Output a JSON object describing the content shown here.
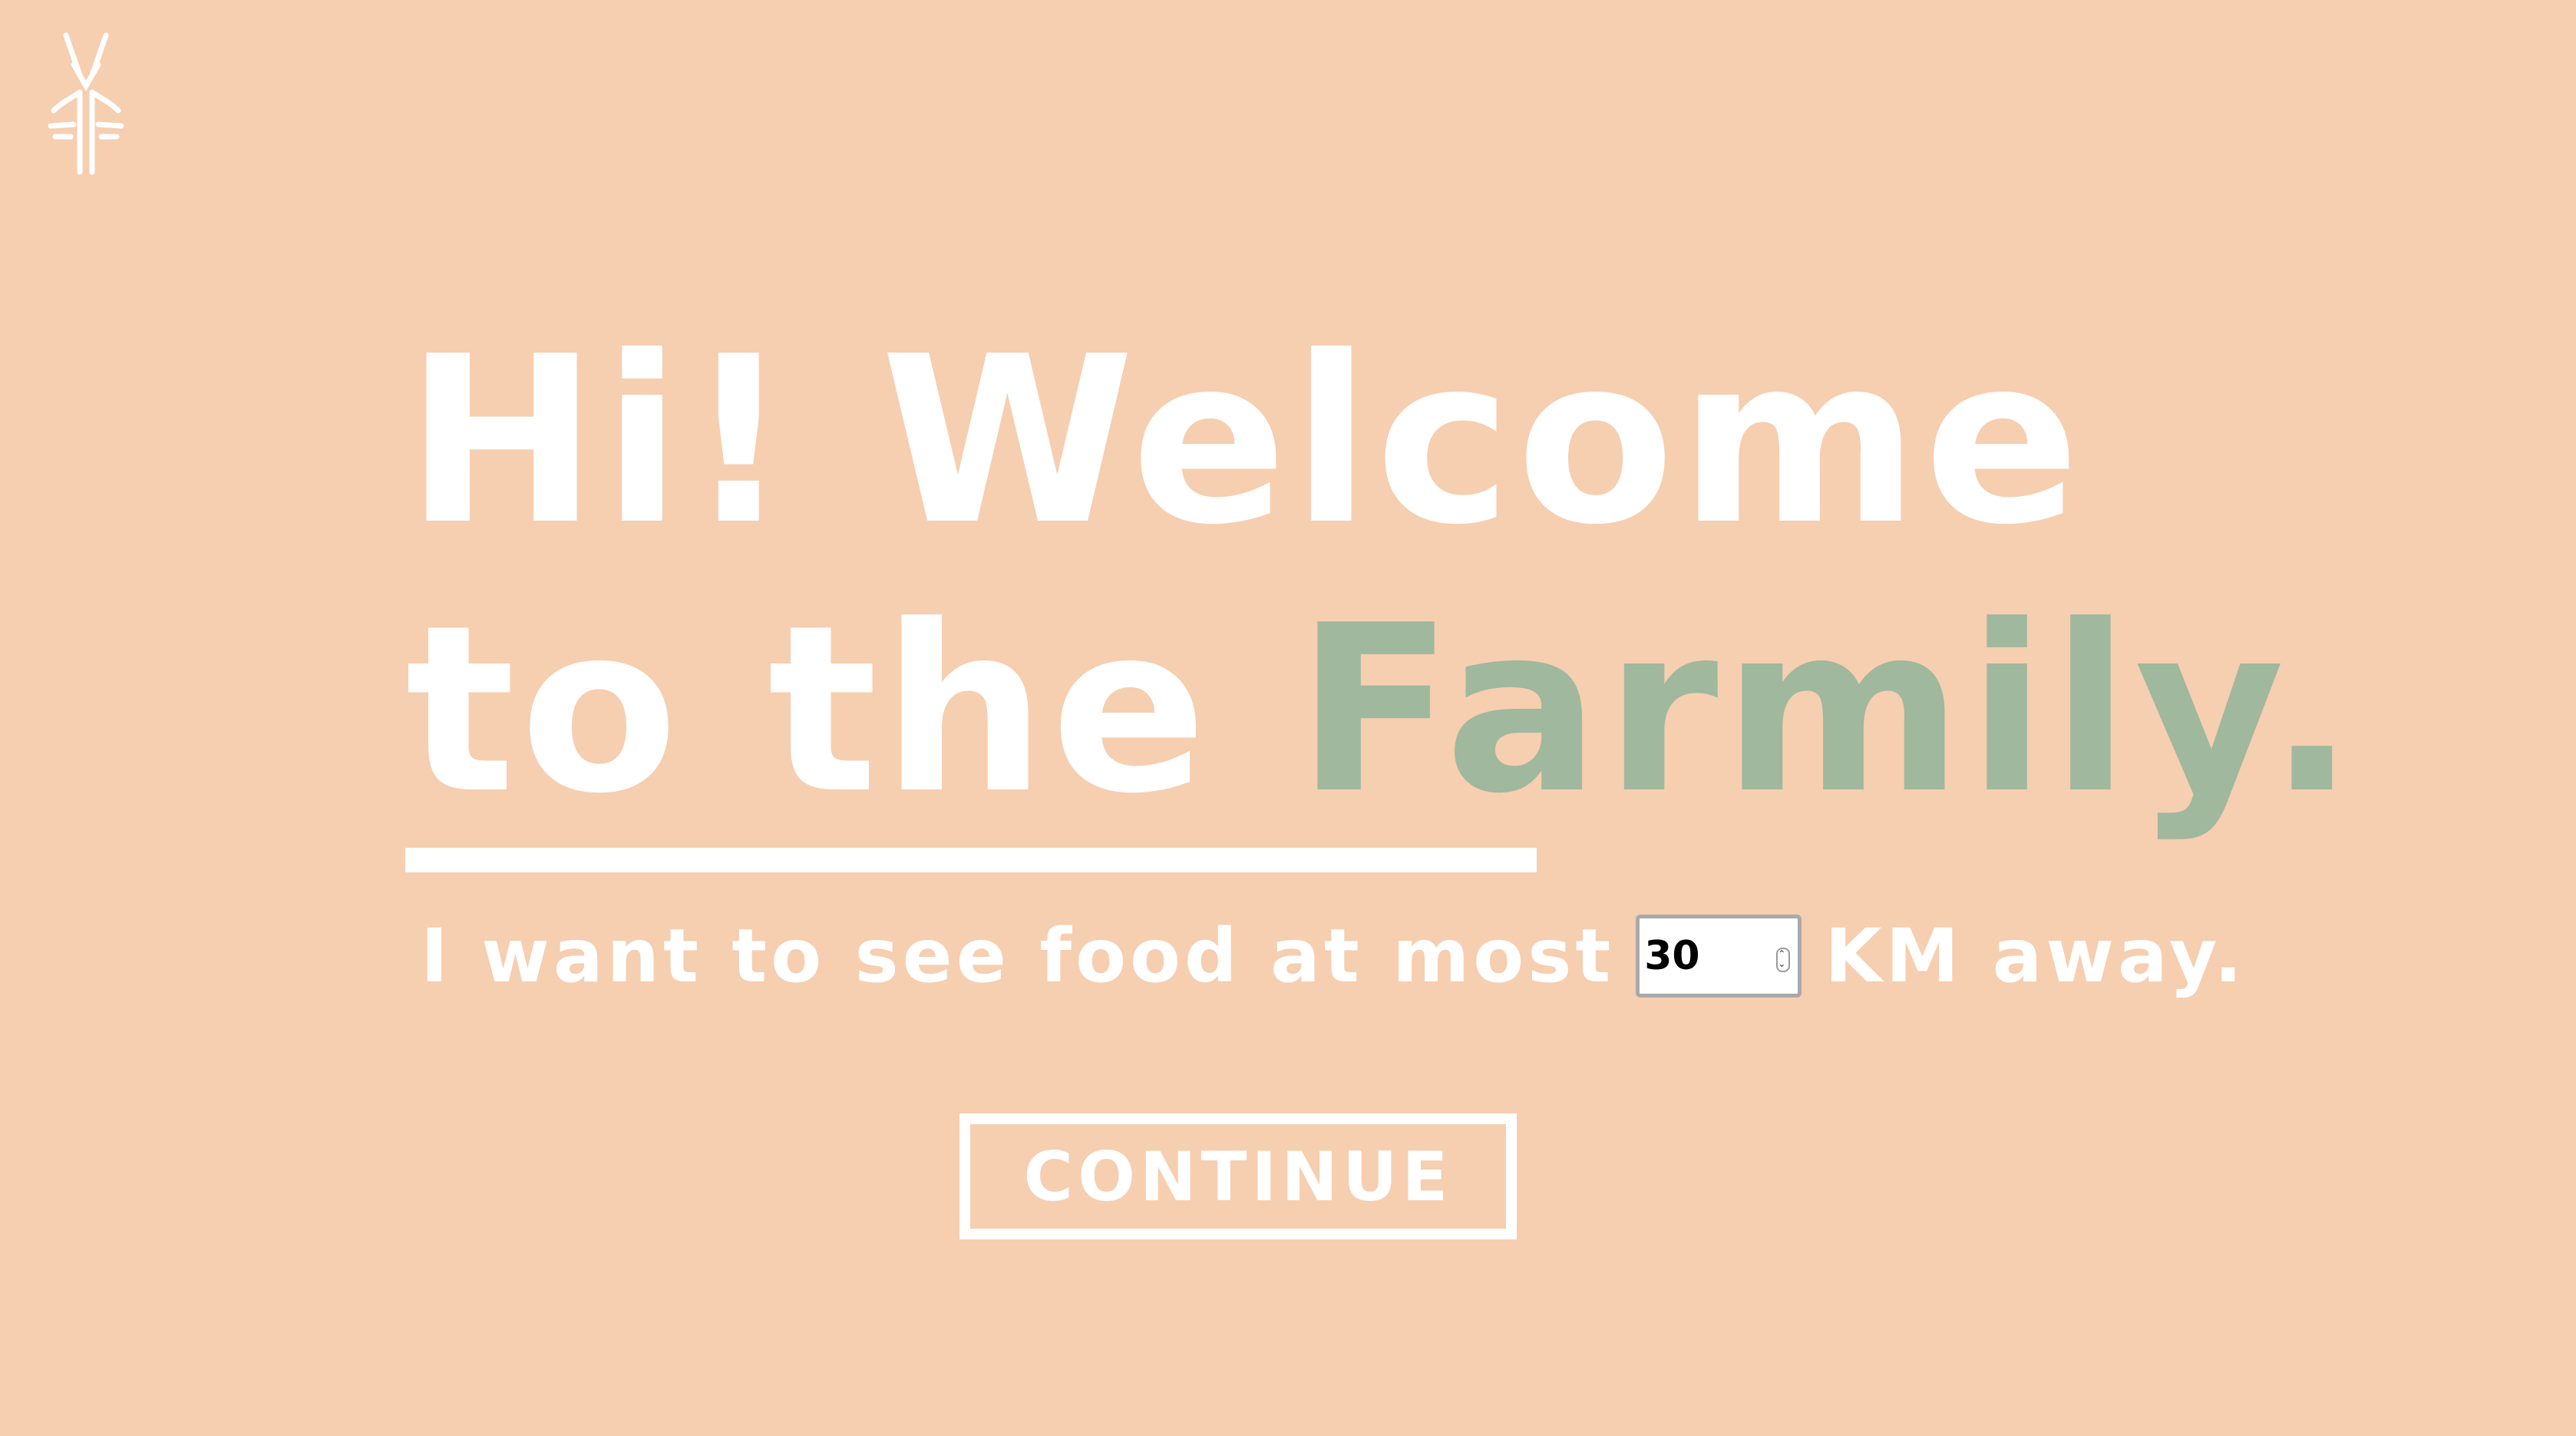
{
  "logo": {
    "icon": "farmily-wheat-logo-icon"
  },
  "hero": {
    "line1": "Hi! Welcome",
    "line2_prefix": "to the ",
    "line2_accent": "Farmily."
  },
  "preference": {
    "prefix": "I want to see food at most",
    "distance_value": "30",
    "suffix": "KM away."
  },
  "actions": {
    "continue_label": "CONTINUE"
  },
  "colors": {
    "background": "#F6CEB0",
    "text": "#FFFFFF",
    "accent": "#9FB89E"
  }
}
